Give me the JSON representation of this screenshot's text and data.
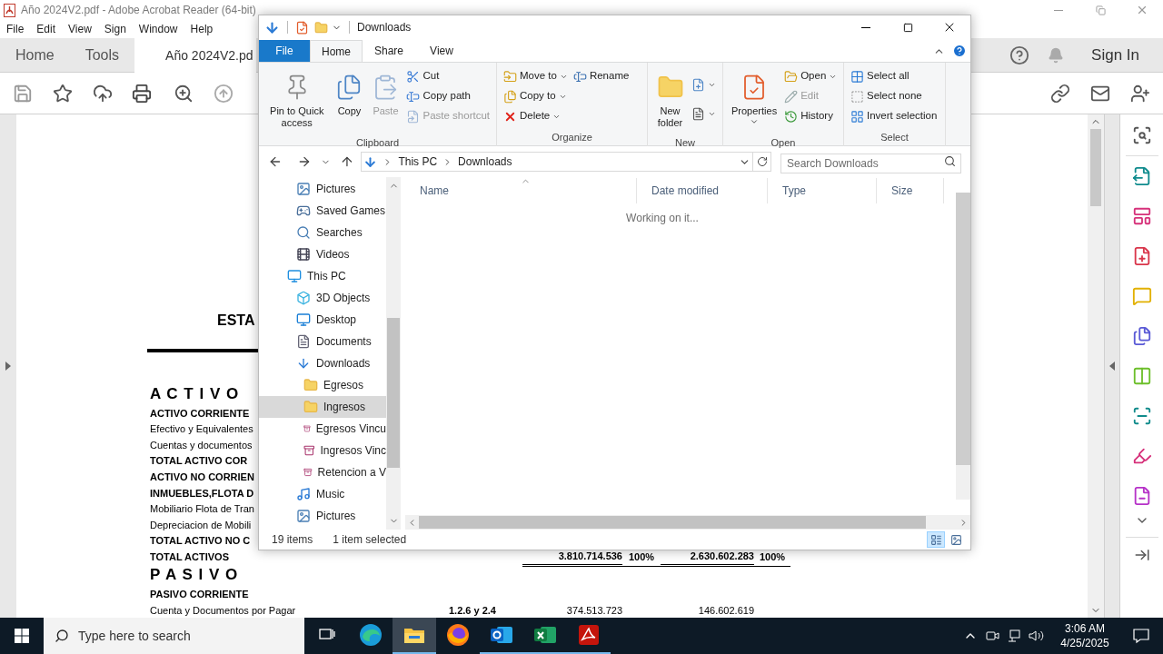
{
  "acrobat": {
    "title": "Año 2024V2.pdf - Adobe Acrobat Reader (64-bit)",
    "menu": [
      "File",
      "Edit",
      "View",
      "Sign",
      "Window",
      "Help"
    ],
    "tabs": [
      {
        "label": "Home",
        "selected": false
      },
      {
        "label": "Tools",
        "selected": false
      },
      {
        "label": "Año 2024V2.pd",
        "selected": true
      }
    ],
    "sign_in": "Sign In",
    "document": {
      "heading": "ESTA",
      "rows": [
        {
          "kind": "section",
          "label": "A C T I V O"
        },
        {
          "kind": "bold",
          "label": "ACTIVO CORRIENTE"
        },
        {
          "kind": "normal",
          "label": "Efectivo y Equivalentes"
        },
        {
          "kind": "normal",
          "label": "Cuentas y documentos"
        },
        {
          "kind": "bold",
          "label": "TOTAL  ACTIVO  COR"
        },
        {
          "kind": "bold",
          "label": "ACTIVO NO CORRIEN"
        },
        {
          "kind": "bold",
          "label": "INMUEBLES,FLOTA D"
        },
        {
          "kind": "normal",
          "label": "Mobiliario Flota de Tran"
        },
        {
          "kind": "normal",
          "label": "Depreciacion de Mobili"
        },
        {
          "kind": "bold",
          "label": "TOTAL  ACTIVO  NO C"
        },
        {
          "kind": "total",
          "label": "TOTAL ACTIVOS",
          "amount_1": "3.810.714.536",
          "percent_1": "100%",
          "amount_2": "2.630.602.283",
          "percent_2": "100%"
        },
        {
          "kind": "section",
          "label": "P A S I V O"
        },
        {
          "kind": "bold",
          "label": "PASIVO CORRIENTE"
        },
        {
          "kind": "normal",
          "label": "Cuenta y Documentos por Pagar",
          "note": "1.2.6 y 2.4",
          "amount_1": "374.513.723",
          "amount_2": "146.602.619"
        }
      ]
    }
  },
  "explorer": {
    "title": "Downloads",
    "ribbon_tabs": [
      {
        "label": "File",
        "kind": "file"
      },
      {
        "label": "Home",
        "kind": "tab",
        "selected": true
      },
      {
        "label": "Share",
        "kind": "tab",
        "selected": false
      },
      {
        "label": "View",
        "kind": "tab",
        "selected": false
      }
    ],
    "groups": [
      {
        "label": "Clipboard",
        "commands": [
          {
            "kind": "large",
            "label": "Pin to Quick access",
            "disabled": false
          },
          {
            "kind": "large",
            "label": "Copy",
            "disabled": false
          },
          {
            "kind": "large",
            "label": "Paste",
            "disabled": true
          },
          {
            "kind": "small",
            "label": "Cut",
            "disabled": false
          },
          {
            "kind": "small",
            "label": "Copy path",
            "disabled": false
          },
          {
            "kind": "small",
            "label": "Paste shortcut",
            "disabled": true
          }
        ]
      },
      {
        "label": "Organize",
        "commands": [
          {
            "kind": "small",
            "label": "Move to",
            "dropdown": true,
            "disabled": false
          },
          {
            "kind": "small",
            "label": "Copy to",
            "dropdown": true,
            "disabled": false
          },
          {
            "kind": "small",
            "label": "Delete",
            "dropdown": true,
            "disabled": false
          },
          {
            "kind": "small",
            "label": "Rename",
            "disabled": false
          }
        ]
      },
      {
        "label": "New",
        "commands": [
          {
            "kind": "large",
            "label": "New folder",
            "disabled": false
          },
          {
            "kind": "small",
            "dropdown": true,
            "disabled": false
          },
          {
            "kind": "small",
            "dropdown": true,
            "disabled": false
          }
        ]
      },
      {
        "label": "Open",
        "commands": [
          {
            "kind": "large",
            "label": "Properties",
            "dropdown": true,
            "disabled": false
          },
          {
            "kind": "small",
            "label": "Open",
            "dropdown": true,
            "disabled": false
          },
          {
            "kind": "small",
            "label": "Edit",
            "disabled": true
          },
          {
            "kind": "small",
            "label": "History",
            "disabled": false
          }
        ]
      },
      {
        "label": "Select",
        "commands": [
          {
            "kind": "small",
            "label": "Select all",
            "disabled": false
          },
          {
            "kind": "small",
            "label": "Select none",
            "disabled": false
          },
          {
            "kind": "small",
            "label": "Invert selection",
            "disabled": false
          }
        ]
      }
    ],
    "path": [
      "This PC",
      "Downloads"
    ],
    "search": {
      "placeholder": "Search Downloads"
    },
    "nav": [
      {
        "kind": "pictures",
        "label": "Pictures",
        "selected": false
      },
      {
        "kind": "games",
        "label": "Saved Games",
        "selected": false
      },
      {
        "kind": "search",
        "label": "Searches",
        "selected": false
      },
      {
        "kind": "videos",
        "label": "Videos",
        "selected": false
      },
      {
        "kind": "pc",
        "label": "This PC",
        "selected": false,
        "children": [
          {
            "kind": "objects",
            "label": "3D Objects",
            "selected": false
          },
          {
            "kind": "desktop",
            "label": "Desktop",
            "selected": false
          },
          {
            "kind": "documents",
            "label": "Documents",
            "selected": false
          },
          {
            "kind": "downloads",
            "label": "Downloads",
            "selected": false,
            "children": [
              {
                "kind": "folder",
                "label": "Egresos",
                "selected": false
              },
              {
                "kind": "folder",
                "label": "Ingresos",
                "selected": true
              },
              {
                "kind": "archive",
                "label": "Egresos Vincu",
                "selected": false
              },
              {
                "kind": "archive",
                "label": "Ingresos Vinc",
                "selected": false
              },
              {
                "kind": "archive",
                "label": "Retencion a V",
                "selected": false
              }
            ]
          },
          {
            "kind": "music",
            "label": "Music",
            "selected": false
          },
          {
            "kind": "pictures",
            "label": "Pictures",
            "selected": false
          }
        ]
      }
    ],
    "columns": [
      {
        "label": "Name",
        "sorted": true
      },
      {
        "label": "Date modified",
        "sorted": false
      },
      {
        "label": "Type",
        "sorted": false
      },
      {
        "label": "Size",
        "sorted": false
      }
    ],
    "message": "Working on it...",
    "status": {
      "count": "19 items",
      "selection": "1 item selected"
    },
    "views": [
      {
        "kind": "details",
        "selected": true
      },
      {
        "kind": "large",
        "selected": false
      }
    ]
  },
  "taskbar": {
    "search": {
      "placeholder": "Type here to search"
    },
    "apps": [
      {
        "kind": "taskview",
        "running": false,
        "selected": false
      },
      {
        "kind": "edge",
        "running": false,
        "selected": false
      },
      {
        "kind": "explorer",
        "running": true,
        "selected": true
      },
      {
        "kind": "firefox",
        "running": false,
        "selected": false
      },
      {
        "kind": "outlook",
        "running": true,
        "selected": false
      },
      {
        "kind": "excel",
        "running": true,
        "selected": false
      },
      {
        "kind": "acrobat",
        "running": true,
        "selected": false
      }
    ],
    "time": "3:06 AM",
    "date": "4/25/2025"
  }
}
